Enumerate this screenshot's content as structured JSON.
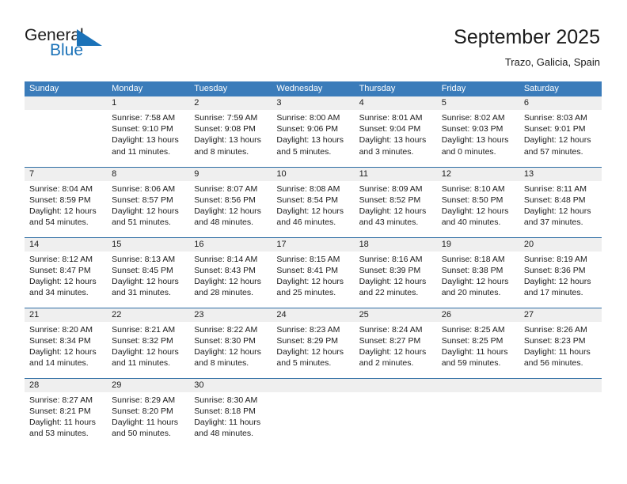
{
  "brand": {
    "name_part1": "General",
    "name_part2": "Blue",
    "flag_icon": "blue-flag-triangle-icon",
    "accent_color": "#1b72b8"
  },
  "header": {
    "title": "September 2025",
    "subtitle": "Trazo, Galicia, Spain"
  },
  "theme": {
    "header_blue": "#3b7cba",
    "row_divider": "#2e6da4",
    "daynum_band": "#efefef"
  },
  "calendar": {
    "day_headers": [
      "Sunday",
      "Monday",
      "Tuesday",
      "Wednesday",
      "Thursday",
      "Friday",
      "Saturday"
    ],
    "weeks": [
      [
        {
          "day": "",
          "sunrise": "",
          "sunset": "",
          "daylight1": "",
          "daylight2": ""
        },
        {
          "day": "1",
          "sunrise": "Sunrise: 7:58 AM",
          "sunset": "Sunset: 9:10 PM",
          "daylight1": "Daylight: 13 hours",
          "daylight2": "and 11 minutes."
        },
        {
          "day": "2",
          "sunrise": "Sunrise: 7:59 AM",
          "sunset": "Sunset: 9:08 PM",
          "daylight1": "Daylight: 13 hours",
          "daylight2": "and 8 minutes."
        },
        {
          "day": "3",
          "sunrise": "Sunrise: 8:00 AM",
          "sunset": "Sunset: 9:06 PM",
          "daylight1": "Daylight: 13 hours",
          "daylight2": "and 5 minutes."
        },
        {
          "day": "4",
          "sunrise": "Sunrise: 8:01 AM",
          "sunset": "Sunset: 9:04 PM",
          "daylight1": "Daylight: 13 hours",
          "daylight2": "and 3 minutes."
        },
        {
          "day": "5",
          "sunrise": "Sunrise: 8:02 AM",
          "sunset": "Sunset: 9:03 PM",
          "daylight1": "Daylight: 13 hours",
          "daylight2": "and 0 minutes."
        },
        {
          "day": "6",
          "sunrise": "Sunrise: 8:03 AM",
          "sunset": "Sunset: 9:01 PM",
          "daylight1": "Daylight: 12 hours",
          "daylight2": "and 57 minutes."
        }
      ],
      [
        {
          "day": "7",
          "sunrise": "Sunrise: 8:04 AM",
          "sunset": "Sunset: 8:59 PM",
          "daylight1": "Daylight: 12 hours",
          "daylight2": "and 54 minutes."
        },
        {
          "day": "8",
          "sunrise": "Sunrise: 8:06 AM",
          "sunset": "Sunset: 8:57 PM",
          "daylight1": "Daylight: 12 hours",
          "daylight2": "and 51 minutes."
        },
        {
          "day": "9",
          "sunrise": "Sunrise: 8:07 AM",
          "sunset": "Sunset: 8:56 PM",
          "daylight1": "Daylight: 12 hours",
          "daylight2": "and 48 minutes."
        },
        {
          "day": "10",
          "sunrise": "Sunrise: 8:08 AM",
          "sunset": "Sunset: 8:54 PM",
          "daylight1": "Daylight: 12 hours",
          "daylight2": "and 46 minutes."
        },
        {
          "day": "11",
          "sunrise": "Sunrise: 8:09 AM",
          "sunset": "Sunset: 8:52 PM",
          "daylight1": "Daylight: 12 hours",
          "daylight2": "and 43 minutes."
        },
        {
          "day": "12",
          "sunrise": "Sunrise: 8:10 AM",
          "sunset": "Sunset: 8:50 PM",
          "daylight1": "Daylight: 12 hours",
          "daylight2": "and 40 minutes."
        },
        {
          "day": "13",
          "sunrise": "Sunrise: 8:11 AM",
          "sunset": "Sunset: 8:48 PM",
          "daylight1": "Daylight: 12 hours",
          "daylight2": "and 37 minutes."
        }
      ],
      [
        {
          "day": "14",
          "sunrise": "Sunrise: 8:12 AM",
          "sunset": "Sunset: 8:47 PM",
          "daylight1": "Daylight: 12 hours",
          "daylight2": "and 34 minutes."
        },
        {
          "day": "15",
          "sunrise": "Sunrise: 8:13 AM",
          "sunset": "Sunset: 8:45 PM",
          "daylight1": "Daylight: 12 hours",
          "daylight2": "and 31 minutes."
        },
        {
          "day": "16",
          "sunrise": "Sunrise: 8:14 AM",
          "sunset": "Sunset: 8:43 PM",
          "daylight1": "Daylight: 12 hours",
          "daylight2": "and 28 minutes."
        },
        {
          "day": "17",
          "sunrise": "Sunrise: 8:15 AM",
          "sunset": "Sunset: 8:41 PM",
          "daylight1": "Daylight: 12 hours",
          "daylight2": "and 25 minutes."
        },
        {
          "day": "18",
          "sunrise": "Sunrise: 8:16 AM",
          "sunset": "Sunset: 8:39 PM",
          "daylight1": "Daylight: 12 hours",
          "daylight2": "and 22 minutes."
        },
        {
          "day": "19",
          "sunrise": "Sunrise: 8:18 AM",
          "sunset": "Sunset: 8:38 PM",
          "daylight1": "Daylight: 12 hours",
          "daylight2": "and 20 minutes."
        },
        {
          "day": "20",
          "sunrise": "Sunrise: 8:19 AM",
          "sunset": "Sunset: 8:36 PM",
          "daylight1": "Daylight: 12 hours",
          "daylight2": "and 17 minutes."
        }
      ],
      [
        {
          "day": "21",
          "sunrise": "Sunrise: 8:20 AM",
          "sunset": "Sunset: 8:34 PM",
          "daylight1": "Daylight: 12 hours",
          "daylight2": "and 14 minutes."
        },
        {
          "day": "22",
          "sunrise": "Sunrise: 8:21 AM",
          "sunset": "Sunset: 8:32 PM",
          "daylight1": "Daylight: 12 hours",
          "daylight2": "and 11 minutes."
        },
        {
          "day": "23",
          "sunrise": "Sunrise: 8:22 AM",
          "sunset": "Sunset: 8:30 PM",
          "daylight1": "Daylight: 12 hours",
          "daylight2": "and 8 minutes."
        },
        {
          "day": "24",
          "sunrise": "Sunrise: 8:23 AM",
          "sunset": "Sunset: 8:29 PM",
          "daylight1": "Daylight: 12 hours",
          "daylight2": "and 5 minutes."
        },
        {
          "day": "25",
          "sunrise": "Sunrise: 8:24 AM",
          "sunset": "Sunset: 8:27 PM",
          "daylight1": "Daylight: 12 hours",
          "daylight2": "and 2 minutes."
        },
        {
          "day": "26",
          "sunrise": "Sunrise: 8:25 AM",
          "sunset": "Sunset: 8:25 PM",
          "daylight1": "Daylight: 11 hours",
          "daylight2": "and 59 minutes."
        },
        {
          "day": "27",
          "sunrise": "Sunrise: 8:26 AM",
          "sunset": "Sunset: 8:23 PM",
          "daylight1": "Daylight: 11 hours",
          "daylight2": "and 56 minutes."
        }
      ],
      [
        {
          "day": "28",
          "sunrise": "Sunrise: 8:27 AM",
          "sunset": "Sunset: 8:21 PM",
          "daylight1": "Daylight: 11 hours",
          "daylight2": "and 53 minutes."
        },
        {
          "day": "29",
          "sunrise": "Sunrise: 8:29 AM",
          "sunset": "Sunset: 8:20 PM",
          "daylight1": "Daylight: 11 hours",
          "daylight2": "and 50 minutes."
        },
        {
          "day": "30",
          "sunrise": "Sunrise: 8:30 AM",
          "sunset": "Sunset: 8:18 PM",
          "daylight1": "Daylight: 11 hours",
          "daylight2": "and 48 minutes."
        },
        {
          "day": "",
          "sunrise": "",
          "sunset": "",
          "daylight1": "",
          "daylight2": ""
        },
        {
          "day": "",
          "sunrise": "",
          "sunset": "",
          "daylight1": "",
          "daylight2": ""
        },
        {
          "day": "",
          "sunrise": "",
          "sunset": "",
          "daylight1": "",
          "daylight2": ""
        },
        {
          "day": "",
          "sunrise": "",
          "sunset": "",
          "daylight1": "",
          "daylight2": ""
        }
      ]
    ]
  }
}
